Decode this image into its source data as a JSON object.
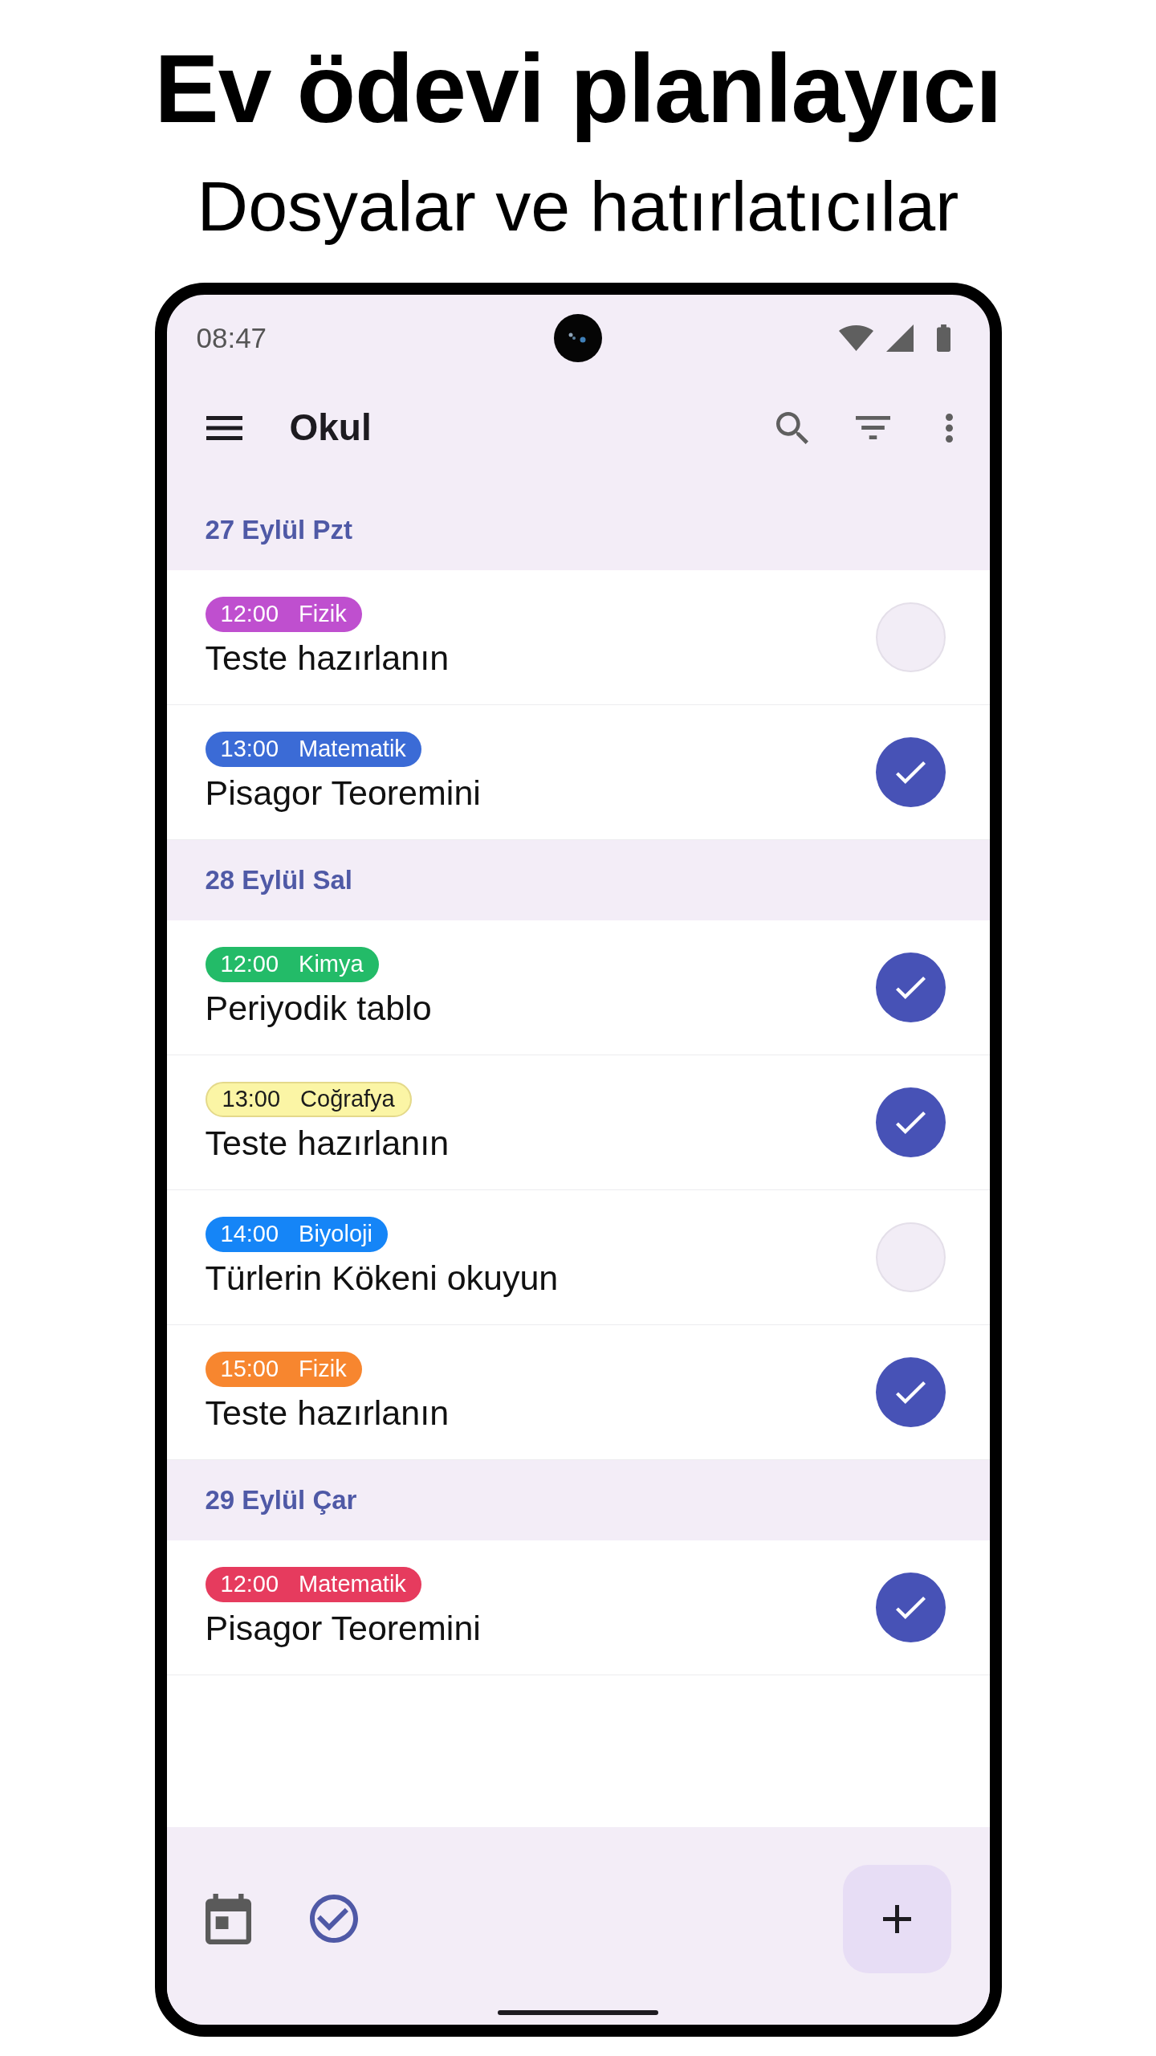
{
  "header": {
    "title": "Ev ödevi planlayıcı",
    "subtitle": "Dosyalar ve hatırlatıcılar"
  },
  "status_bar": {
    "time": "08:47"
  },
  "app_bar": {
    "title": "Okul"
  },
  "sections": [
    {
      "date": "27 Eylül Pzt",
      "tasks": [
        {
          "time": "12:00",
          "subject": "Fizik",
          "color": "#bf4fcf",
          "title": "Teste hazırlanın",
          "checked": false
        },
        {
          "time": "13:00",
          "subject": "Matematik",
          "color": "#3b6bd6",
          "title": "Pisagor Teoremini",
          "checked": true
        }
      ]
    },
    {
      "date": "28 Eylül Sal",
      "tasks": [
        {
          "time": "12:00",
          "subject": "Kimya",
          "color": "#23bb68",
          "title": "Periyodik tablo",
          "checked": true
        },
        {
          "time": "13:00",
          "subject": "Coğrafya",
          "color": "#fbf5a5",
          "title": "Teste hazırlanın",
          "checked": true
        },
        {
          "time": "14:00",
          "subject": "Biyoloji",
          "color": "#1585f7",
          "title": "Türlerin Kökeni okuyun",
          "checked": false
        },
        {
          "time": "15:00",
          "subject": "Fizik",
          "color": "#f7862f",
          "title": "Teste hazırlanın",
          "checked": true
        }
      ]
    },
    {
      "date": "29 Eylül Çar",
      "tasks": [
        {
          "time": "12:00",
          "subject": "Matematik",
          "color": "#e63b5e",
          "title": "Pisagor Teoremini",
          "checked": true
        }
      ]
    }
  ],
  "bottom_bar": {
    "tabs": [
      {
        "kind": "calendar",
        "selected": false
      },
      {
        "kind": "tasks",
        "selected": true
      }
    ]
  }
}
